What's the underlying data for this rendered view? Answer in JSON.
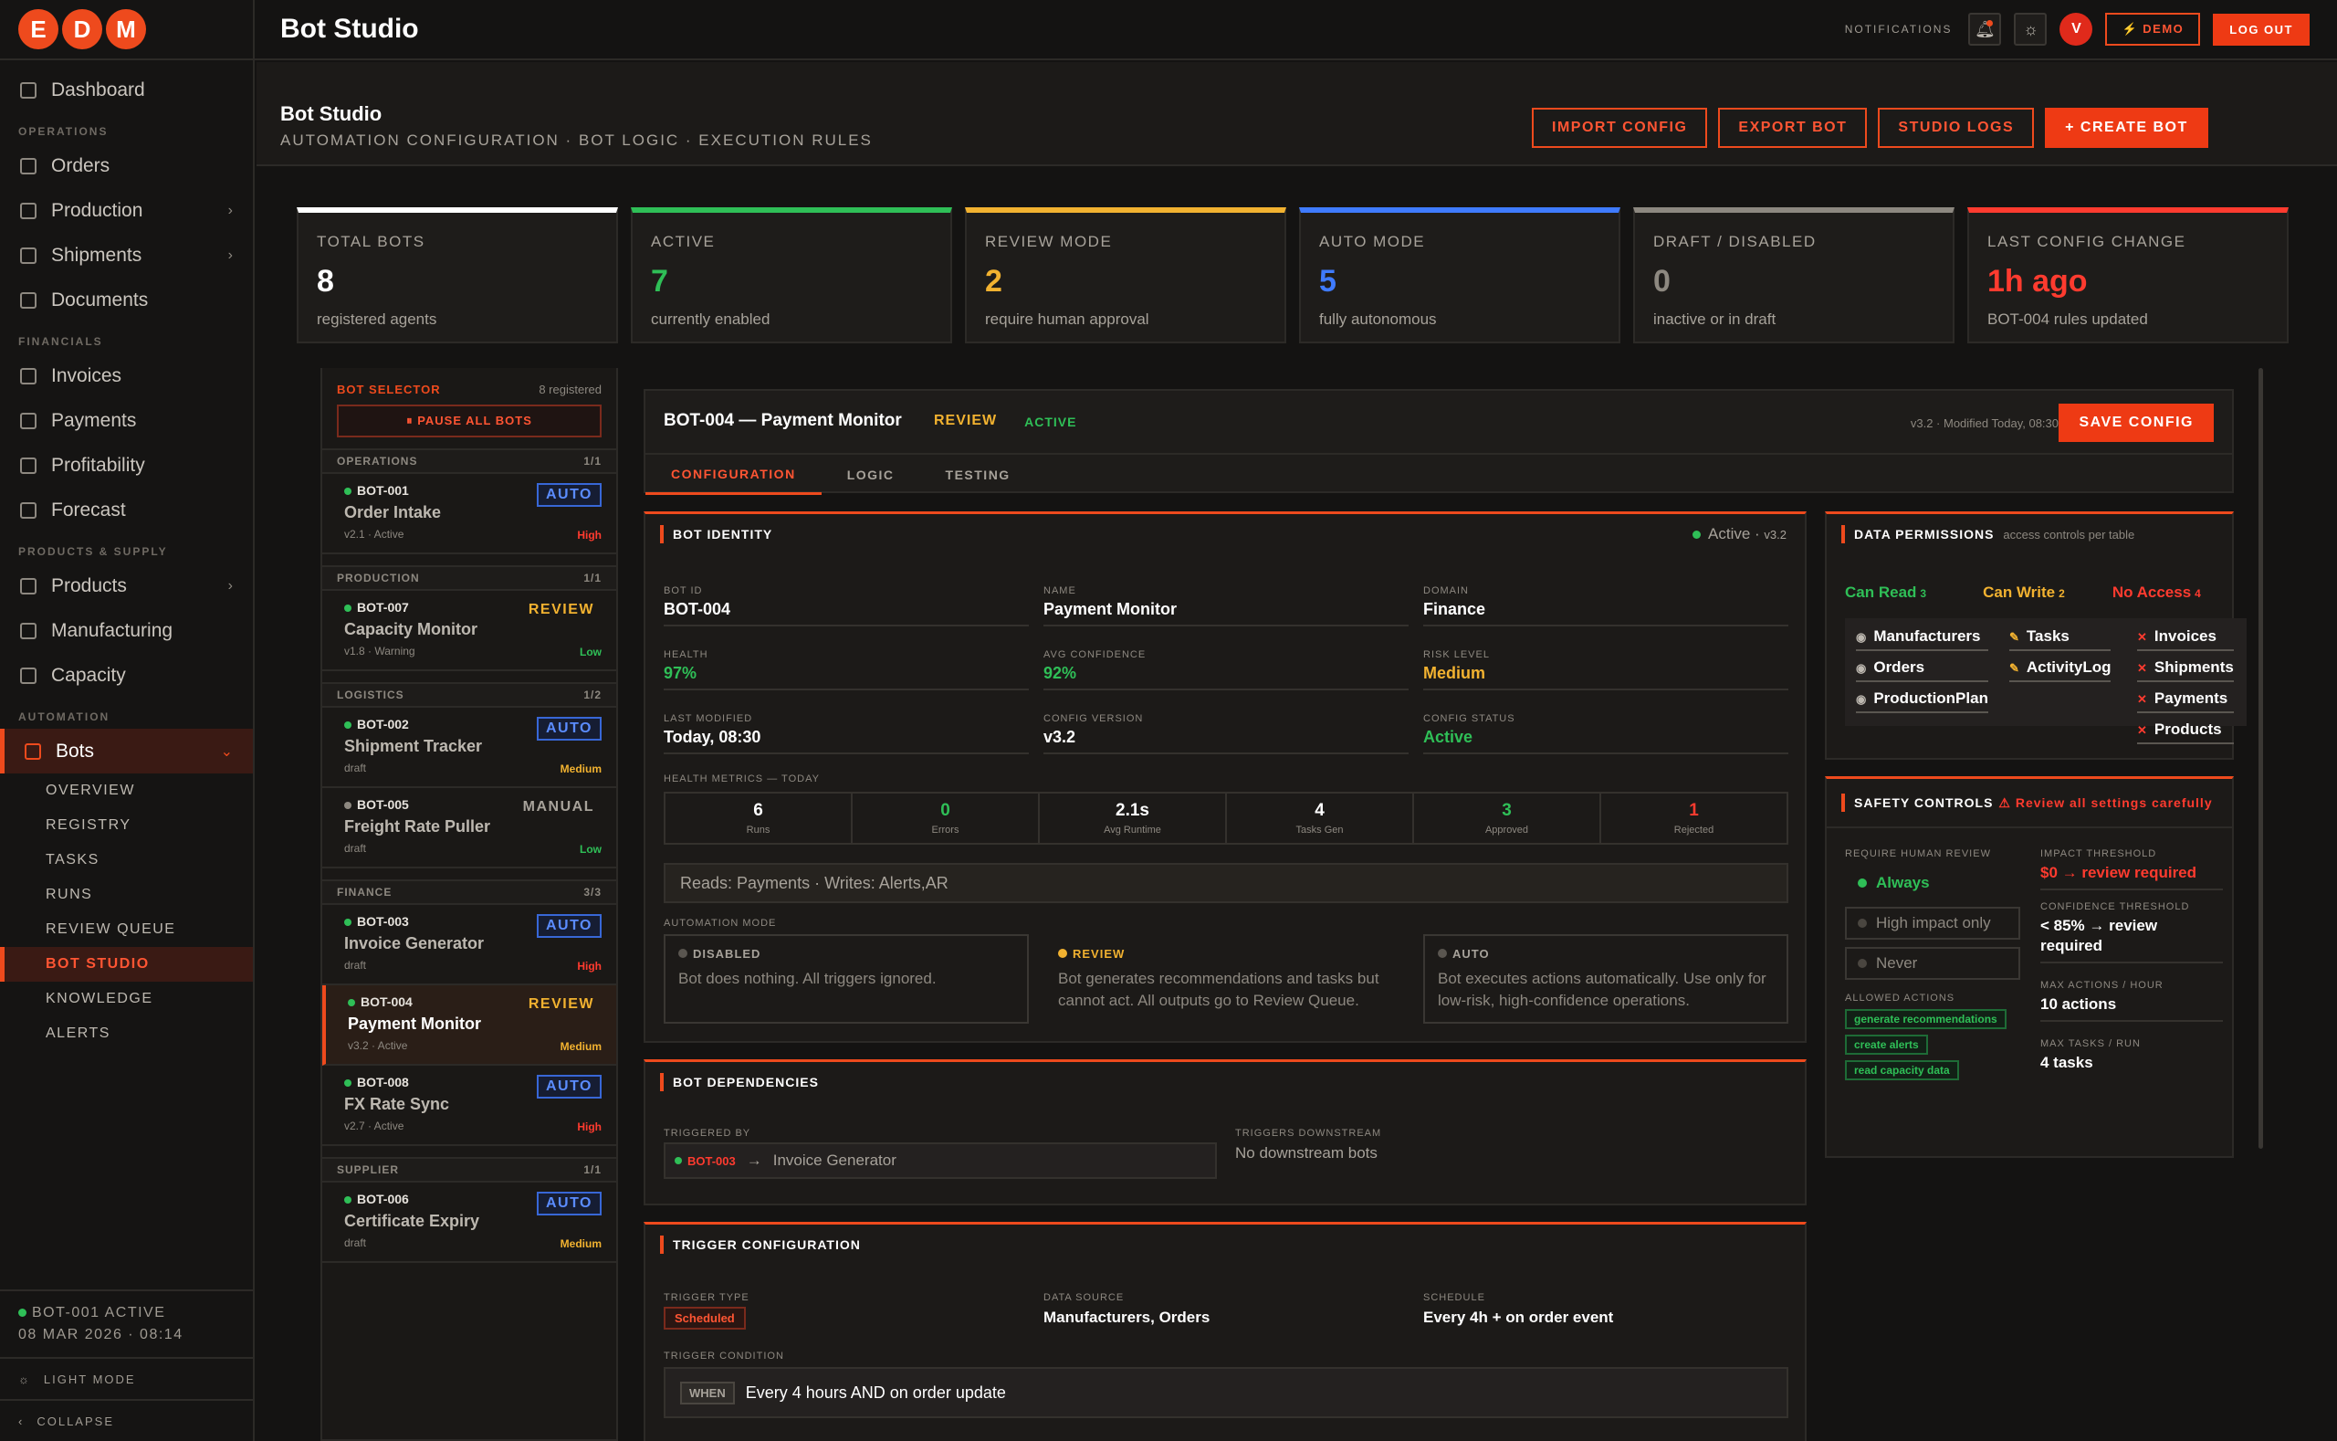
{
  "app": {
    "logo_letters": [
      "E",
      "D",
      "M"
    ],
    "title": "Bot Studio"
  },
  "sidebar": {
    "dashboard": "Dashboard",
    "sections": {
      "operations": "OPERATIONS",
      "financials": "FINANCIALS",
      "products": "PRODUCTS & SUPPLY",
      "automation": "AUTOMATION"
    },
    "operations": [
      {
        "label": "Orders",
        "chev": false
      },
      {
        "label": "Production",
        "chev": true
      },
      {
        "label": "Shipments",
        "chev": true
      },
      {
        "label": "Documents",
        "chev": false
      }
    ],
    "financials": [
      "Invoices",
      "Payments",
      "Profitability",
      "Forecast"
    ],
    "products": [
      {
        "label": "Products",
        "chev": true
      },
      {
        "label": "Manufacturing",
        "chev": false
      },
      {
        "label": "Capacity",
        "chev": false
      }
    ],
    "bots_label": "Bots",
    "bots_sub": [
      "OVERVIEW",
      "REGISTRY",
      "TASKS",
      "RUNS",
      "REVIEW QUEUE",
      "BOT STUDIO",
      "KNOWLEDGE",
      "ALERTS"
    ],
    "status_line1": "BOT-001 ACTIVE",
    "status_line2": "08 MAR 2026 · 08:14",
    "light_mode": "LIGHT MODE",
    "collapse": "COLLAPSE"
  },
  "topbar": {
    "notifications": "NOTIFICATIONS",
    "avatar": "V",
    "demo": "⚡ DEMO",
    "logout": "LOG OUT"
  },
  "page": {
    "title": "Bot Studio",
    "subtitle": "AUTOMATION CONFIGURATION · BOT LOGIC · EXECUTION RULES",
    "actions": {
      "import": "IMPORT CONFIG",
      "export": "EXPORT BOT",
      "logs": "STUDIO LOGS",
      "create": "+ CREATE BOT"
    }
  },
  "kpis": [
    {
      "label": "TOTAL BOTS",
      "value": "8",
      "desc": "registered agents",
      "color": "#ffffff"
    },
    {
      "label": "ACTIVE",
      "value": "7",
      "desc": "currently enabled",
      "color": "#2fbf57"
    },
    {
      "label": "REVIEW MODE",
      "value": "2",
      "desc": "require human approval",
      "color": "#f2b230"
    },
    {
      "label": "AUTO MODE",
      "value": "5",
      "desc": "fully autonomous",
      "color": "#3f7bff"
    },
    {
      "label": "DRAFT / DISABLED",
      "value": "0",
      "desc": "inactive or in draft",
      "color": "#8d8880"
    },
    {
      "label": "LAST CONFIG CHANGE",
      "value": "1h ago",
      "desc": "BOT-004 rules updated",
      "color": "#ff3b2f"
    }
  ],
  "selector": {
    "title": "BOT SELECTOR",
    "count": "8 registered",
    "pause": "⏸ PAUSE ALL BOTS",
    "groups": [
      {
        "name": "OPERATIONS",
        "count": "1/1",
        "bots": [
          {
            "id": "BOT-001",
            "name": "Order Intake",
            "meta": "v2.1 · Active",
            "mode": "AUTO",
            "risk": "High",
            "active": true
          }
        ]
      },
      {
        "name": "PRODUCTION",
        "count": "1/1",
        "bots": [
          {
            "id": "BOT-007",
            "name": "Capacity Monitor",
            "meta": "v1.8 · Warning",
            "mode": "REVIEW",
            "risk": "Low",
            "active": true
          }
        ]
      },
      {
        "name": "LOGISTICS",
        "count": "1/2",
        "bots": [
          {
            "id": "BOT-002",
            "name": "Shipment Tracker",
            "meta": "draft",
            "mode": "AUTO",
            "risk": "Medium",
            "active": true
          },
          {
            "id": "BOT-005",
            "name": "Freight Rate Puller",
            "meta": "draft",
            "mode": "MANUAL",
            "risk": "Low",
            "active": false
          }
        ]
      },
      {
        "name": "FINANCE",
        "count": "3/3",
        "bots": [
          {
            "id": "BOT-003",
            "name": "Invoice Generator",
            "meta": "draft",
            "mode": "AUTO",
            "risk": "High",
            "active": true
          },
          {
            "id": "BOT-004",
            "name": "Payment Monitor",
            "meta": "v3.2 · Active",
            "mode": "REVIEW",
            "risk": "Medium",
            "active": true,
            "selected": true
          },
          {
            "id": "BOT-008",
            "name": "FX Rate Sync",
            "meta": "v2.7 · Active",
            "mode": "AUTO",
            "risk": "High",
            "active": true
          }
        ]
      },
      {
        "name": "SUPPLIER",
        "count": "1/1",
        "bots": [
          {
            "id": "BOT-006",
            "name": "Certificate Expiry",
            "meta": "draft",
            "mode": "AUTO",
            "risk": "Medium",
            "active": true
          }
        ]
      }
    ]
  },
  "bot": {
    "title": "BOT-004 — Payment Monitor",
    "mode": "REVIEW",
    "status": "ACTIVE",
    "meta": "v3.2 · Modified Today, 08:30",
    "save": "SAVE CONFIG",
    "tabs": [
      "CONFIGURATION",
      "LOGIC",
      "TESTING"
    ],
    "identity": {
      "header": "BOT IDENTITY",
      "status": "Active",
      "version": "v3.2",
      "fields": [
        {
          "label": "BOT ID",
          "value": "BOT-004",
          "color": "#ffffff"
        },
        {
          "label": "NAME",
          "value": "Payment Monitor",
          "color": "#ffffff"
        },
        {
          "label": "DOMAIN",
          "value": "Finance",
          "color": "#ffffff"
        },
        {
          "label": "HEALTH",
          "value": "97%",
          "color": "#2fbf57"
        },
        {
          "label": "AVG CONFIDENCE",
          "value": "92%",
          "color": "#2fbf57"
        },
        {
          "label": "RISK LEVEL",
          "value": "Medium",
          "color": "#f2b230"
        },
        {
          "label": "LAST MODIFIED",
          "value": "Today, 08:30",
          "color": "#ffffff"
        },
        {
          "label": "CONFIG VERSION",
          "value": "v3.2",
          "color": "#ffffff"
        },
        {
          "label": "CONFIG STATUS",
          "value": "Active",
          "color": "#2fbf57"
        }
      ],
      "metrics_label": "HEALTH METRICS — TODAY",
      "metrics": [
        {
          "n": "6",
          "t": "Runs",
          "c": "#ffffff"
        },
        {
          "n": "0",
          "t": "Errors",
          "c": "#2fbf57"
        },
        {
          "n": "2.1s",
          "t": "Avg Runtime",
          "c": "#ffffff"
        },
        {
          "n": "4",
          "t": "Tasks Gen",
          "c": "#ffffff"
        },
        {
          "n": "3",
          "t": "Approved",
          "c": "#2fbf57"
        },
        {
          "n": "1",
          "t": "Rejected",
          "c": "#ff3b2f"
        }
      ],
      "reads_writes": "Reads: Payments · Writes: Alerts,AR",
      "mode_label": "AUTOMATION MODE",
      "modes": [
        {
          "t": "DISABLED",
          "d": "Bot does nothing. All triggers ignored."
        },
        {
          "t": "REVIEW",
          "d": "Bot generates recommendations and tasks but cannot act. All outputs go to Review Queue."
        },
        {
          "t": "AUTO",
          "d": "Bot executes actions automatically. Use only for low-risk, high-confidence operations."
        }
      ]
    },
    "permissions": {
      "header": "DATA PERMISSIONS",
      "sub": "access controls per table",
      "can_read": "Can Read",
      "can_read_n": "3",
      "can_write": "Can Write",
      "can_write_n": "2",
      "no_access": "No Access",
      "no_access_n": "4",
      "read": [
        "Manufacturers",
        "Orders",
        "ProductionPlan"
      ],
      "write": [
        "Tasks",
        "ActivityLog"
      ],
      "none": [
        "Invoices",
        "Shipments",
        "Payments",
        "Products"
      ]
    },
    "safety": {
      "header": "SAFETY CONTROLS",
      "warn": "⚠ Review all settings carefully",
      "review_label": "REQUIRE HUMAN REVIEW",
      "options": [
        "Always",
        "High impact only",
        "Never"
      ],
      "allowed_label": "ALLOWED ACTIONS",
      "allowed": [
        "generate recommendations",
        "create alerts",
        "read capacity data"
      ],
      "impact_label": "IMPACT THRESHOLD",
      "impact": "$0 → review required",
      "conf_label": "CONFIDENCE THRESHOLD",
      "conf": "< 85% → review required",
      "max_hour_label": "MAX ACTIONS / HOUR",
      "max_hour": "10 actions",
      "max_run_label": "MAX TASKS / RUN",
      "max_run": "4 tasks"
    },
    "deps": {
      "header": "BOT DEPENDENCIES",
      "triggered_by_label": "TRIGGERED BY",
      "triggered_by_id": "BOT-003",
      "triggered_by_name": "Invoice Generator",
      "downstream_label": "TRIGGERS DOWNSTREAM",
      "downstream": "No downstream bots"
    },
    "trigger": {
      "header": "TRIGGER CONFIGURATION",
      "type_label": "TRIGGER TYPE",
      "type": "Scheduled",
      "source_label": "DATA SOURCE",
      "source": "Manufacturers, Orders",
      "schedule_label": "SCHEDULE",
      "schedule": "Every 4h + on order event",
      "cond_label": "TRIGGER CONDITION",
      "when": "WHEN",
      "cond": "Every 4 hours AND on order update"
    }
  }
}
